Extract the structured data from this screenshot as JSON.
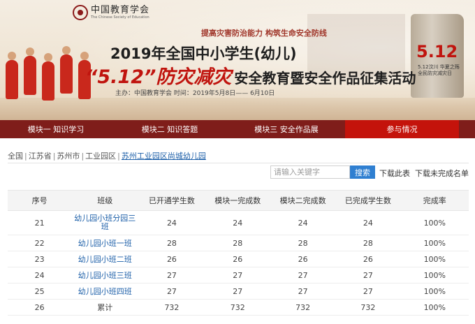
{
  "banner": {
    "logo_cn": "中国教育学会",
    "logo_en": "The Chinese Society of Education",
    "slogan": "提高灾害防治能力 构筑生命安全防线",
    "title_line1": "2019年全国中小学生(幼儿)",
    "title_red": "“5.12”防灾减灾",
    "title_dark": "安全教育暨安全作品征集活动",
    "organizer": "主办：中国教育学会   时间：2019年5月8日—— 6月10日",
    "monument_number": "5.12",
    "monument_text": "5.12汶川 华夏之殇 全民防灾减灾日"
  },
  "nav": {
    "items": [
      {
        "label": "模块一 知识学习"
      },
      {
        "label": "模块二 知识答题"
      },
      {
        "label": "模块三 安全作品展"
      },
      {
        "label": "参与情况"
      }
    ]
  },
  "breadcrumb": {
    "items": [
      "全国",
      "江苏省",
      "苏州市",
      "工业园区"
    ],
    "current": "苏州工业园区尚城幼儿园",
    "separator": "|"
  },
  "search": {
    "placeholder": "请输入关键字",
    "button": "搜索",
    "link_download_table": "下载此表",
    "link_download_incomplete": "下载未完成名单"
  },
  "table": {
    "headers": [
      "序号",
      "班级",
      "已开通学生数",
      "模块一完成数",
      "模块二完成数",
      "已完成学生数",
      "完成率"
    ],
    "rows": [
      [
        "21",
        "幼儿园小班分园三班",
        "24",
        "24",
        "24",
        "24",
        "100%"
      ],
      [
        "22",
        "幼儿园小班一班",
        "28",
        "28",
        "28",
        "28",
        "100%"
      ],
      [
        "23",
        "幼儿园小班二班",
        "26",
        "26",
        "26",
        "26",
        "100%"
      ],
      [
        "24",
        "幼儿园小班三班",
        "27",
        "27",
        "27",
        "27",
        "100%"
      ],
      [
        "25",
        "幼儿园小班四班",
        "27",
        "27",
        "27",
        "27",
        "100%"
      ],
      [
        "26",
        "累计",
        "732",
        "732",
        "732",
        "732",
        "100%"
      ]
    ]
  }
}
